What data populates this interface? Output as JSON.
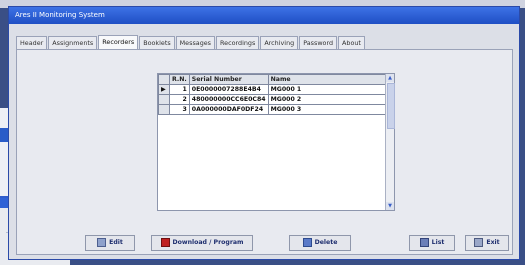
{
  "window": {
    "title": "Ares II Monitoring System"
  },
  "tabs": [
    "Header",
    "Assignments",
    "Recorders",
    "Booklets",
    "Messages",
    "Recordings",
    "Archiving",
    "Password",
    "About"
  ],
  "active_tab": "Recorders",
  "grid": {
    "headers": [
      "R.N.",
      "Serial Number",
      "Name"
    ],
    "rows": [
      {
        "rn": "1",
        "serial": "0E0000007288E4B4",
        "name": "MG000 1"
      },
      {
        "rn": "2",
        "serial": "480000000CC6E0C84",
        "name": "MG000 2"
      },
      {
        "rn": "3",
        "serial": "0A000000DAF0DF24",
        "name": "MG000 3"
      }
    ]
  },
  "buttons": {
    "edit": "Edit",
    "download": "Download / Program",
    "delete": "Delete",
    "list": "List",
    "exit": "Exit"
  },
  "colors": {
    "accent": "#2a5ed8",
    "button_text": "#1f2f6f"
  }
}
